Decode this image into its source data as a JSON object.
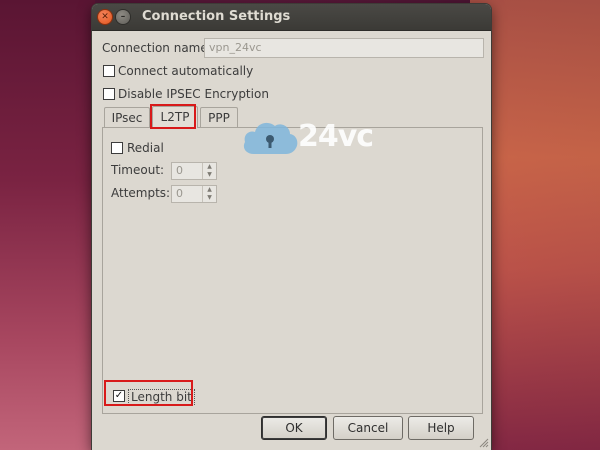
{
  "window": {
    "title": "Connection Settings",
    "close_glyph": "✕",
    "min_glyph": "–"
  },
  "form": {
    "connection_name_label": "Connection name:",
    "connection_name_value": "vpn_24vc",
    "connect_automatically_label": "Connect automatically",
    "connect_automatically_checked": false,
    "disable_ipsec_label": "Disable IPSEC Encryption",
    "disable_ipsec_checked": false
  },
  "tabs": [
    {
      "label": "IPsec",
      "active": false
    },
    {
      "label": "L2TP",
      "active": true
    },
    {
      "label": "PPP",
      "active": false
    }
  ],
  "l2tp": {
    "redial_label": "Redial",
    "redial_checked": false,
    "timeout_label": "Timeout:",
    "timeout_value": "0",
    "attempts_label": "Attempts:",
    "attempts_value": "0",
    "length_bit_label": "Length bit",
    "length_bit_checked": true
  },
  "buttons": {
    "ok": "OK",
    "cancel": "Cancel",
    "help": "Help"
  },
  "watermark": {
    "text": "24vc"
  },
  "colors": {
    "highlight": "#d81a1a",
    "watermark_cloud": "#7fb6dc"
  }
}
